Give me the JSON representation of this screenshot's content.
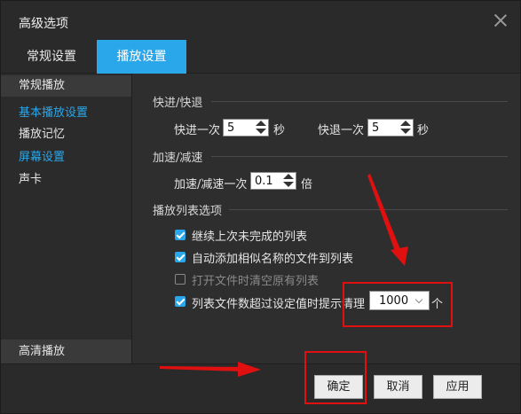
{
  "window": {
    "title": "高级选项"
  },
  "tabs": [
    {
      "label": "常规设置",
      "active": false
    },
    {
      "label": "播放设置",
      "active": true
    }
  ],
  "sidebar": {
    "items": [
      {
        "label": "常规播放"
      },
      {
        "label": "基本播放设置"
      },
      {
        "label": "播放记忆"
      },
      {
        "label": "屏幕设置"
      },
      {
        "label": "声卡"
      }
    ],
    "bottom": "高清播放"
  },
  "seek": {
    "section": "快进/快退",
    "forward_label": "快进一次",
    "forward_value": "5",
    "forward_unit": "秒",
    "backward_label": "快退一次",
    "backward_value": "5",
    "backward_unit": "秒"
  },
  "speed": {
    "section": "加速/减速",
    "label": "加速/减速一次",
    "value": "0.1",
    "unit": "倍"
  },
  "playlist": {
    "section": "播放列表选项",
    "options": [
      {
        "label": "继续上次未完成的列表",
        "checked": true
      },
      {
        "label": "自动添加相似名称的文件到列表",
        "checked": true
      },
      {
        "label": "打开文件时清空原有列表",
        "checked": false
      },
      {
        "label": "列表文件数超过设定值时提示清理",
        "checked": true
      }
    ],
    "limit_value": "1000",
    "limit_unit": "个"
  },
  "footer": {
    "ok": "确定",
    "cancel": "取消",
    "apply": "应用"
  },
  "colors": {
    "accent": "#2aa7ea",
    "annotation": "#e01010"
  }
}
